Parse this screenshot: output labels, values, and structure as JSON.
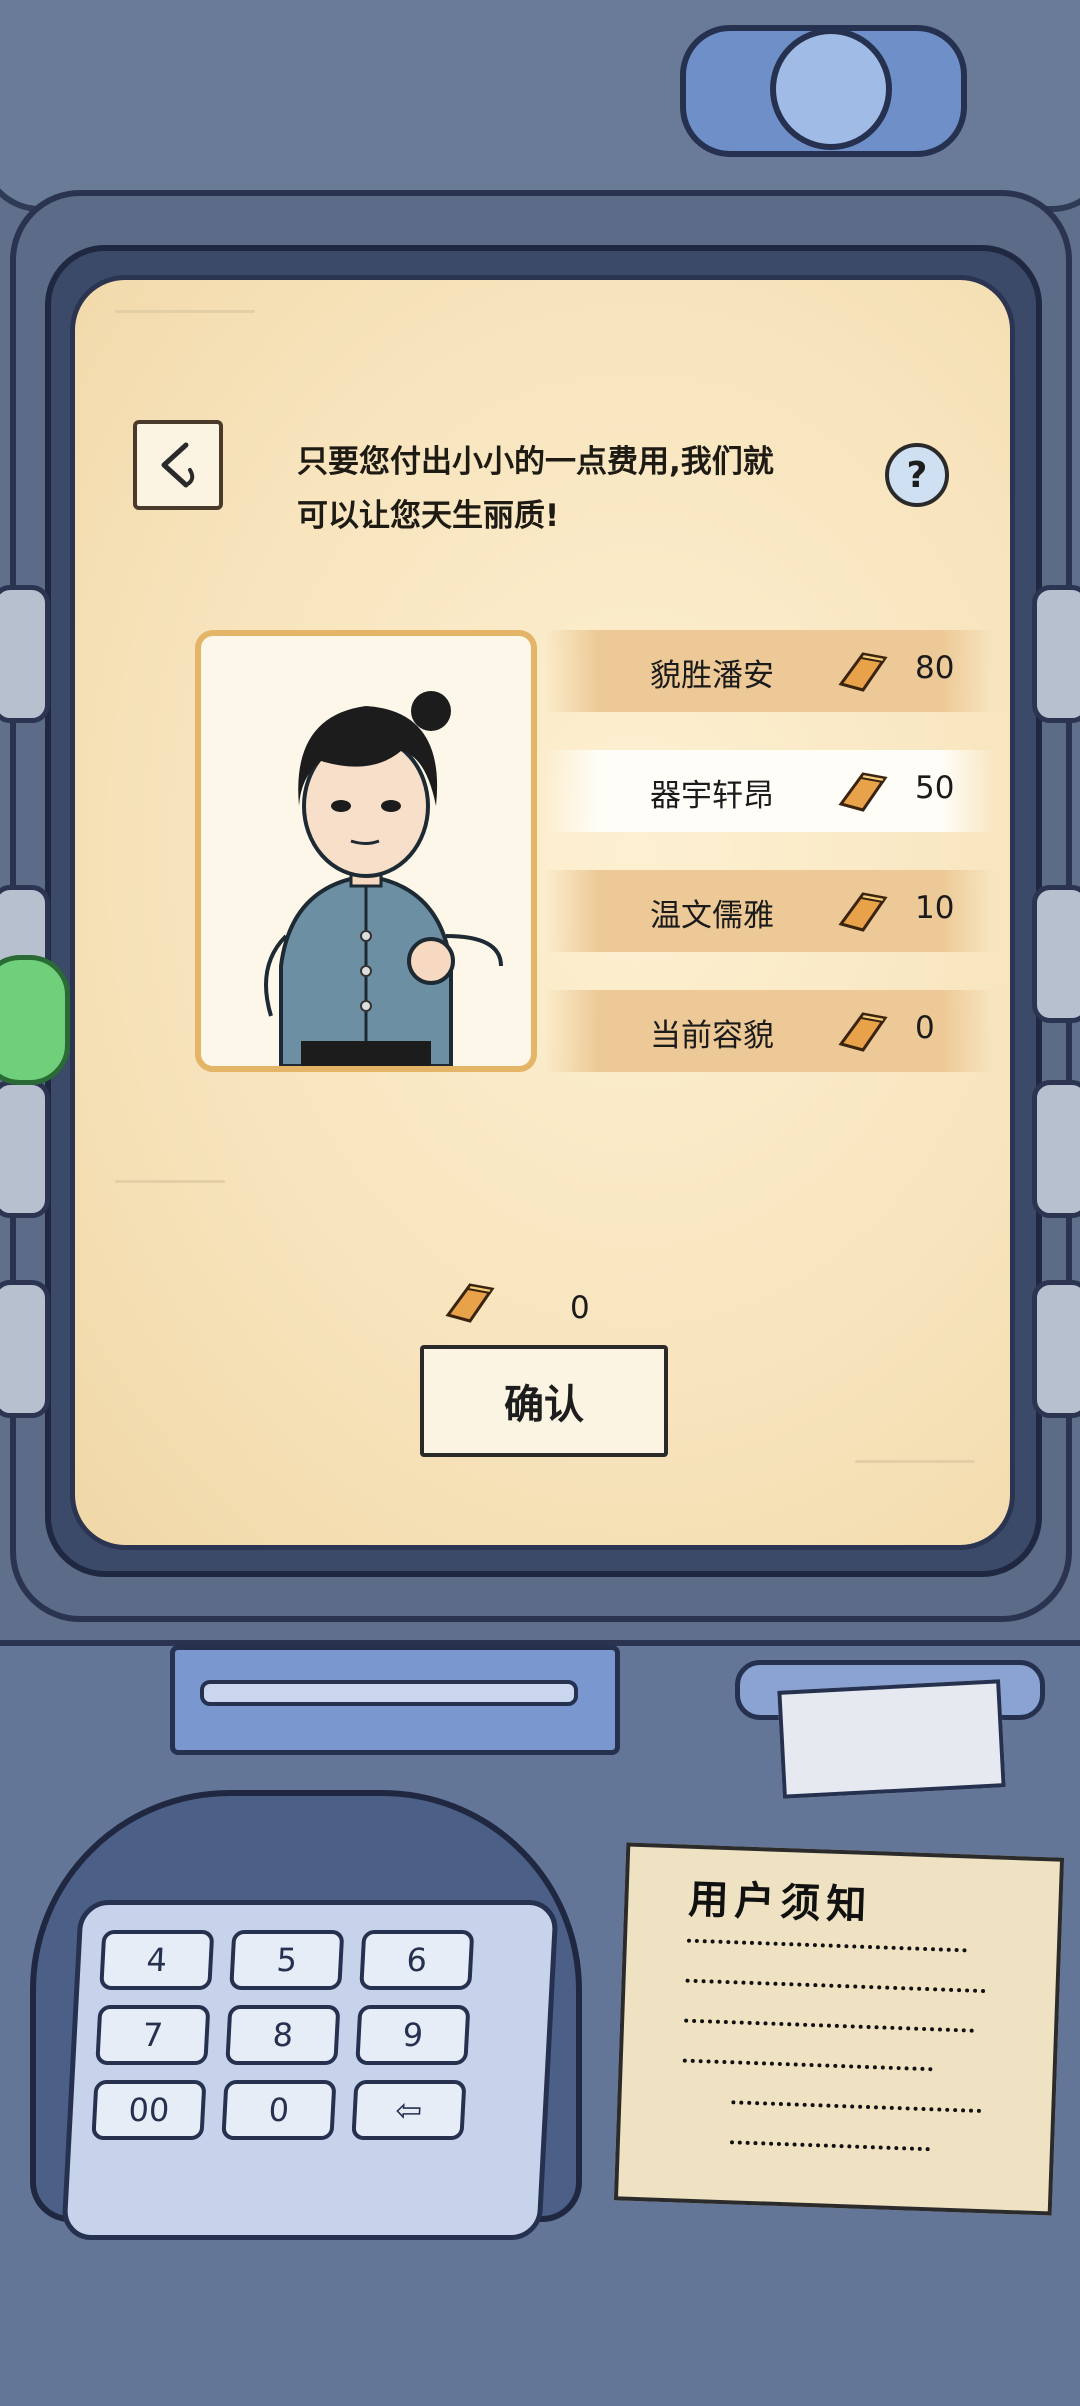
{
  "prompt": {
    "line1": "只要您付出小小的一点费用,我们就",
    "line2": "可以让您天生丽质!"
  },
  "help_label": "?",
  "options": [
    {
      "label": "貌胜潘安",
      "cost": "80",
      "selected": false
    },
    {
      "label": "器宇轩昂",
      "cost": "50",
      "selected": true
    },
    {
      "label": "温文儒雅",
      "cost": "10",
      "selected": false
    },
    {
      "label": "当前容貌",
      "cost": "0",
      "selected": false
    }
  ],
  "total_cost": "0",
  "confirm_label": "确认",
  "keypad": {
    "row1": [
      "4",
      "5",
      "6"
    ],
    "row2": [
      "7",
      "8",
      "9"
    ],
    "row3": [
      "00",
      "0",
      "⇦"
    ]
  },
  "notice": {
    "title": "用户须知"
  },
  "colors": {
    "screen_bg": "#f7e3bb",
    "card_border": "#e4b467",
    "option_bg": "#ecc996",
    "option_selected_bg": "#fffdf8",
    "gold_bar": "#e8a24a",
    "atm_body": "#5f6f8c"
  },
  "icons": {
    "back": "chevron-left-icon",
    "help": "question-icon",
    "currency": "gold-bar-icon"
  }
}
